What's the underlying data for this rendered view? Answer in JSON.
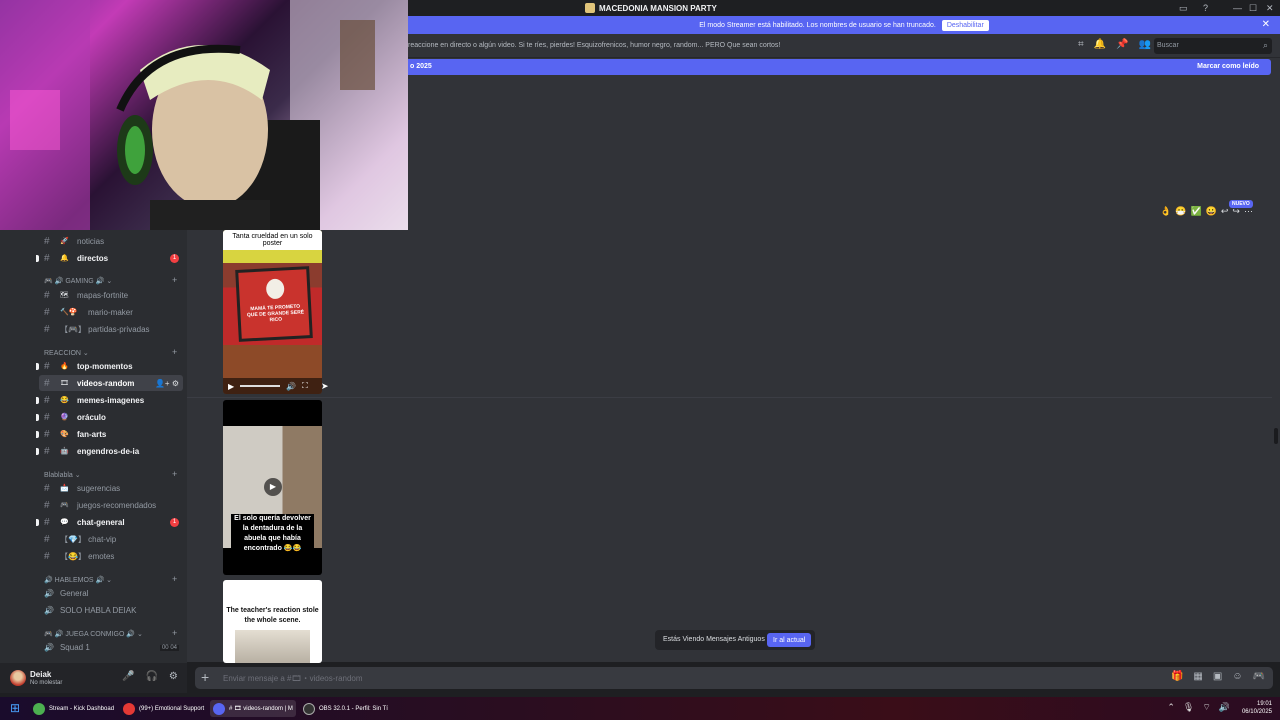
{
  "window": {
    "title": "MACEDONIA MANSION PARTY",
    "minimize": "—",
    "maximize": "☐",
    "close": "✕"
  },
  "banner": {
    "text": "El modo Streamer está habilitado. Los nombres de usuario se han truncado.",
    "button": "Deshabilitar"
  },
  "topic": {
    "text": "reaccione en directo o algún video. Si te ríes, pierdes! Esquizofrenicos, humor negro, random... PERO Que sean cortos!",
    "search_placeholder": "Buscar"
  },
  "new_bar": {
    "left": "o 2025",
    "right": "Marcar como leído"
  },
  "sidebar": {
    "channels": [
      {
        "emoji": "🚀",
        "name": "noticias",
        "unread": false
      },
      {
        "emoji": "🔔",
        "name": "directos",
        "unread": true,
        "badge": "1"
      }
    ],
    "cat_gaming": "🎮 🔊 GAMING 🔊 ⌄",
    "gaming": [
      {
        "emoji": "🗺",
        "name": "mapas-fortnite"
      },
      {
        "emoji": "🔨🍄",
        "name": "mario-maker"
      },
      {
        "emoji": "",
        "name": "【🎮】 partidas-privadas"
      }
    ],
    "cat_reaccion": "REACCION ⌄",
    "reaccion": [
      {
        "emoji": "🔥",
        "name": "top-momentos"
      },
      {
        "emoji": "🎞",
        "name": "videos-random",
        "active": true
      },
      {
        "emoji": "😂",
        "name": "memes-imagenes"
      },
      {
        "emoji": "🔮",
        "name": "oráculo"
      },
      {
        "emoji": "🎨",
        "name": "fan-arts"
      },
      {
        "emoji": "🤖",
        "name": "engendros-de-ia"
      }
    ],
    "cat_blabla": "Blablabla ⌄",
    "blabla": [
      {
        "emoji": "📩",
        "name": "sugerencias",
        "unread": false
      },
      {
        "emoji": "🎮",
        "name": "juegos-recomendados",
        "unread": false
      },
      {
        "emoji": "💬",
        "name": "chat-general",
        "unread": true,
        "badge": "1"
      },
      {
        "emoji": "",
        "name": "【💎】 chat-vip",
        "unread": false
      },
      {
        "emoji": "",
        "name": "【😂】 emotes",
        "unread": false
      }
    ],
    "cat_hablemos": "🔊 HABLEMOS 🔊 ⌄",
    "voice": [
      "General",
      "SOLO HABLA DEIAK"
    ],
    "cat_juega": "🎮 🔊 JUEGA CONMIGO 🔊 ⌄",
    "squad": {
      "name": "Squad 1",
      "count_a": "00",
      "count_b": "04"
    }
  },
  "user": {
    "name": "Deiak",
    "status": "No molestar"
  },
  "composer": {
    "placeholder": "Enviar mensaje a #🎞・videos-random"
  },
  "media": {
    "m1_caption": "Tanta crueldad en un solo poster",
    "m1_tv_text": "MAMÁ TE PROMETO QUE DE GRANDE SERÉ RICO",
    "m2_caption": "El solo quería devolver la dentadura de la abuela que había encontrado 😂😂",
    "m3_caption": "The teacher's reaction stole the whole scene."
  },
  "reactions": {
    "emojis": [
      "👌",
      "😷",
      "✅",
      "😀",
      "↩",
      "↪",
      "⋯"
    ],
    "nuevo": "NUEVO"
  },
  "old_messages": {
    "text": "Estás Viendo Mensajes Antiguos",
    "button": "Ir al actual"
  },
  "taskbar": {
    "apps": [
      {
        "label": "Stream - Kick Dashboad",
        "color": "#4caf50"
      },
      {
        "label": "(99+) Emotional Support",
        "color": "#e53935"
      },
      {
        "label": "# 🎞 videos-random | M",
        "color": "#5865f2",
        "active": true
      },
      {
        "label": "OBS 32.0.1 - Perfil: Sin Tí",
        "color": "#333333"
      }
    ],
    "time": "19:01",
    "date": "06/10/2025"
  },
  "colors": {
    "blurple": "#5865f2",
    "bg": "#313338",
    "sidebar": "#2b2d31",
    "red": "#f23f42"
  }
}
